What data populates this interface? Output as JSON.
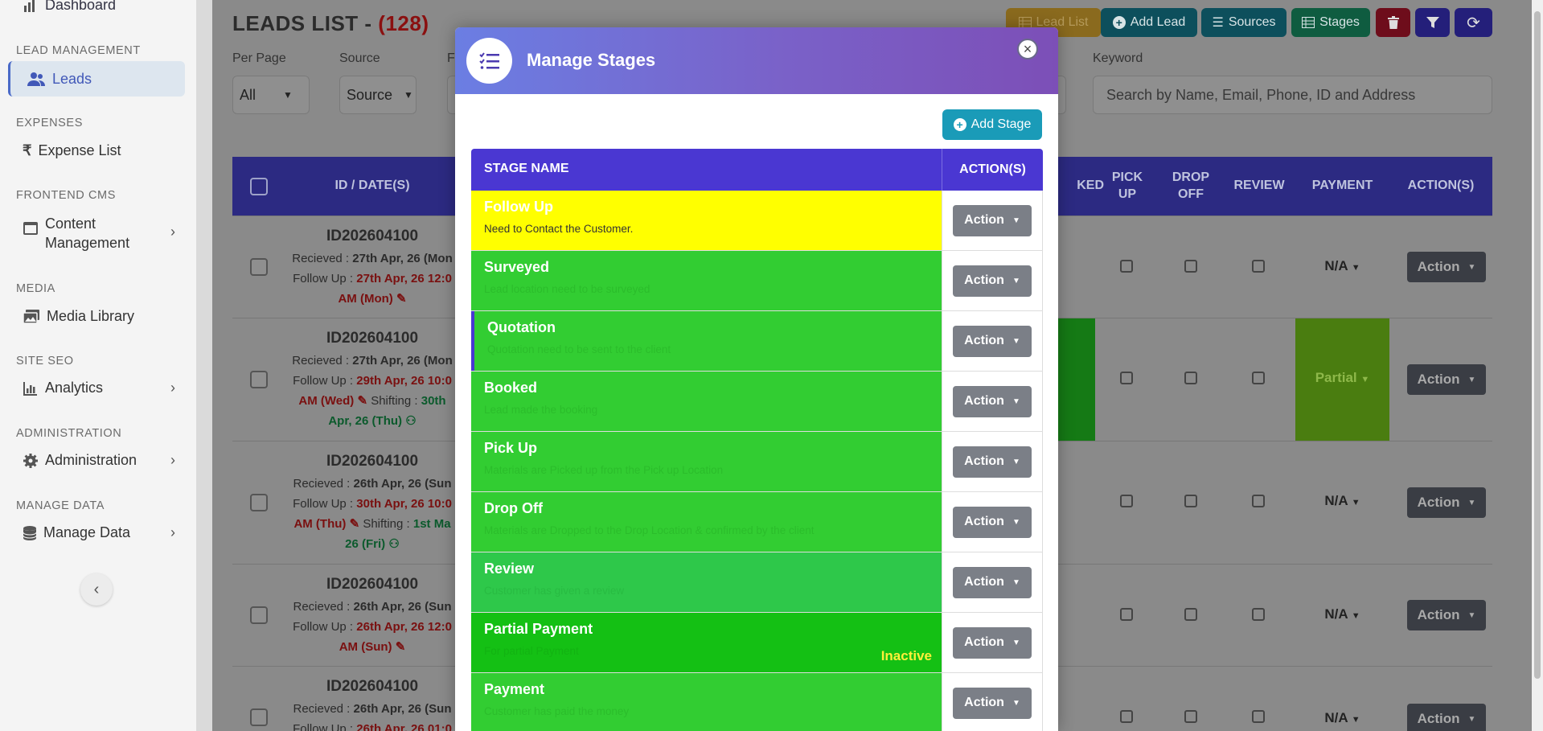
{
  "sidebar": {
    "dashboard_label": "Dashboard",
    "sections": {
      "lead_management": "LEAD MANAGEMENT",
      "expenses": "EXPENSES",
      "frontend_cms": "FRONTEND CMS",
      "media": "MEDIA",
      "site_seo": "SITE SEO",
      "administration": "ADMINISTRATION",
      "manage_data": "MANAGE DATA"
    },
    "items": {
      "leads": "Leads",
      "expense_list": "Expense List",
      "content_management_1": "Content",
      "content_management_2": "Management",
      "media_library": "Media Library",
      "analytics": "Analytics",
      "administration": "Administration",
      "manage_data": "Manage Data"
    },
    "collapse_glyph": "‹"
  },
  "page": {
    "title": "LEADS LIST - ",
    "count": "(128)"
  },
  "toolbar": {
    "lead_list": "Lead List",
    "add_lead": "Add Lead",
    "sources": "Sources",
    "stages": "Stages"
  },
  "filters": {
    "per_page_label": "Per Page",
    "per_page_value": "All",
    "source_label": "Source",
    "source_value": "Source",
    "third_label_partial": "F",
    "keyword_label": "Keyword",
    "keyword_placeholder": "Search by Name, Email, Phone, ID and Address"
  },
  "table": {
    "headers": {
      "id_date": "ID / DATE(S)",
      "booked_partial": "KED",
      "pick_up": "PICK UP",
      "drop_off": "DROP OFF",
      "review": "REVIEW",
      "payment": "PAYMENT",
      "actions": "ACTION(S)"
    },
    "rows": [
      {
        "id": "ID202604100",
        "received_label": "Recieved : ",
        "received": "27th Apr, 26 (Mon",
        "follow_label": "Follow Up : ",
        "follow": "27th Apr, 26 12:0",
        "follow2": "AM (Mon)",
        "payment": "N/A",
        "action": "Action"
      },
      {
        "id": "ID202604100",
        "received_label": "Recieved : ",
        "received": "27th Apr, 26 (Mon",
        "follow_label": "Follow Up : ",
        "follow": "29th Apr, 26 10:0",
        "follow2": "AM (Wed)",
        "shifting_label": " Shifting : ",
        "shifting": "30th",
        "shifting2": "Apr, 26 (Thu)",
        "payment": "Partial",
        "action": "Action"
      },
      {
        "id": "ID202604100",
        "received_label": "Recieved : ",
        "received": "26th Apr, 26 (Sun",
        "follow_label": "Follow Up : ",
        "follow": "30th Apr, 26 10:0",
        "follow2": "AM (Thu)",
        "shifting_label": " Shifting : ",
        "shifting": "1st Ma",
        "shifting2": "26 (Fri)",
        "payment": "N/A",
        "action": "Action"
      },
      {
        "id": "ID202604100",
        "received_label": "Recieved : ",
        "received": "26th Apr, 26 (Sun",
        "follow_label": "Follow Up : ",
        "follow": "26th Apr, 26 12:0",
        "follow2": "AM (Sun)",
        "payment": "N/A",
        "action": "Action"
      },
      {
        "id": "ID202604100",
        "received_label": "Recieved : ",
        "received": "26th Apr, 26 (Sun",
        "follow_label": "Follow Up : ",
        "follow": "26th Apr, 26 01:0",
        "payment": "N/A",
        "action": "Action"
      }
    ]
  },
  "modal": {
    "title": "Manage Stages",
    "close_glyph": "×",
    "add_stage_label": "Add Stage",
    "col_stage_name": "STAGE NAME",
    "col_actions": "ACTION(S)",
    "action_label": "Action",
    "stages": [
      {
        "name": "Follow Up",
        "description": "Need to Contact the Customer.",
        "bg": "#ffff00",
        "name_color": "#ffffff",
        "desc_color": "#333333",
        "status": ""
      },
      {
        "name": "Surveyed",
        "description": "Lead location need to be surveyed",
        "bg": "#32cd32",
        "name_color": "#ffffff",
        "desc_color": "#2bbd2b",
        "status": ""
      },
      {
        "name": "Quotation",
        "description": "Quotation need to be sent to the client",
        "bg": "#32cd32",
        "name_color": "#ffffff",
        "desc_color": "#2bbd2b",
        "status": ""
      },
      {
        "name": "Booked",
        "description": "Lead made the booking",
        "bg": "#32cd32",
        "name_color": "#ffffff",
        "desc_color": "#2bbd2b",
        "status": ""
      },
      {
        "name": "Pick Up",
        "description": "Materials are Picked up from the Pick up Location",
        "bg": "#32cd32",
        "name_color": "#ffffff",
        "desc_color": "#2bbd2b",
        "status": ""
      },
      {
        "name": "Drop Off",
        "description": "Materials are Dropped to the Drop Location & confirmed by the client",
        "bg": "#32cd32",
        "name_color": "#ffffff",
        "desc_color": "#2bbd2b",
        "status": ""
      },
      {
        "name": "Review",
        "description": "Customer has given a review",
        "bg": "#2ec84a",
        "name_color": "#ffffff",
        "desc_color": "#28bb42",
        "status": ""
      },
      {
        "name": "Partial Payment",
        "description": "For partial Payment",
        "bg": "#14c014",
        "name_color": "#ffffff",
        "desc_color": "#12b312",
        "status": "Inactive"
      },
      {
        "name": "Payment",
        "description": "Customer has paid the money",
        "bg": "#32cd32",
        "name_color": "#ffffff",
        "desc_color": "#2bbd2b",
        "status": ""
      }
    ]
  }
}
